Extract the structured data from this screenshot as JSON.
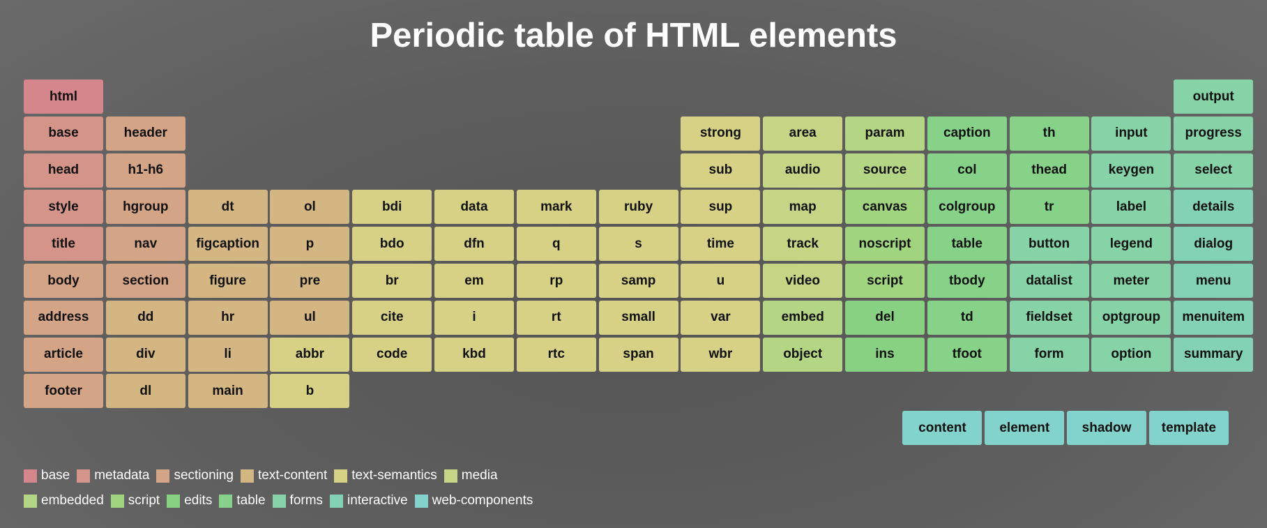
{
  "title": "Periodic table of HTML elements",
  "colors": {
    "base": "#d5868c",
    "metadata": "#d4948a",
    "sectioning": "#d4a487",
    "text-content": "#d4b683",
    "text-semantics": "#d6d185",
    "media": "#c5d485",
    "embedded": "#b4d583",
    "script": "#a1d47f",
    "edits": "#89d182",
    "table": "#86d289",
    "forms": "#85d3a6",
    "interactive": "#84d2b6",
    "web-components": "#83d3cd"
  },
  "elements": [
    {
      "label": "html",
      "col": 0,
      "row": 0,
      "cat": "base"
    },
    {
      "label": "base",
      "col": 0,
      "row": 1,
      "cat": "metadata"
    },
    {
      "label": "head",
      "col": 0,
      "row": 2,
      "cat": "metadata"
    },
    {
      "label": "style",
      "col": 0,
      "row": 3,
      "cat": "metadata"
    },
    {
      "label": "title",
      "col": 0,
      "row": 4,
      "cat": "metadata"
    },
    {
      "label": "body",
      "col": 0,
      "row": 5,
      "cat": "sectioning"
    },
    {
      "label": "address",
      "col": 0,
      "row": 6,
      "cat": "sectioning"
    },
    {
      "label": "article",
      "col": 0,
      "row": 7,
      "cat": "sectioning"
    },
    {
      "label": "footer",
      "col": 0,
      "row": 8,
      "cat": "sectioning"
    },
    {
      "label": "header",
      "col": 1,
      "row": 1,
      "cat": "sectioning"
    },
    {
      "label": "h1-h6",
      "col": 1,
      "row": 2,
      "cat": "sectioning"
    },
    {
      "label": "hgroup",
      "col": 1,
      "row": 3,
      "cat": "sectioning"
    },
    {
      "label": "nav",
      "col": 1,
      "row": 4,
      "cat": "sectioning"
    },
    {
      "label": "section",
      "col": 1,
      "row": 5,
      "cat": "sectioning"
    },
    {
      "label": "dd",
      "col": 1,
      "row": 6,
      "cat": "text-content"
    },
    {
      "label": "div",
      "col": 1,
      "row": 7,
      "cat": "text-content"
    },
    {
      "label": "dl",
      "col": 1,
      "row": 8,
      "cat": "text-content"
    },
    {
      "label": "dt",
      "col": 2,
      "row": 3,
      "cat": "text-content"
    },
    {
      "label": "figcaption",
      "col": 2,
      "row": 4,
      "cat": "text-content"
    },
    {
      "label": "figure",
      "col": 2,
      "row": 5,
      "cat": "text-content"
    },
    {
      "label": "hr",
      "col": 2,
      "row": 6,
      "cat": "text-content"
    },
    {
      "label": "li",
      "col": 2,
      "row": 7,
      "cat": "text-content"
    },
    {
      "label": "main",
      "col": 2,
      "row": 8,
      "cat": "text-content"
    },
    {
      "label": "ol",
      "col": 3,
      "row": 3,
      "cat": "text-content"
    },
    {
      "label": "p",
      "col": 3,
      "row": 4,
      "cat": "text-content"
    },
    {
      "label": "pre",
      "col": 3,
      "row": 5,
      "cat": "text-content"
    },
    {
      "label": "ul",
      "col": 3,
      "row": 6,
      "cat": "text-content"
    },
    {
      "label": "abbr",
      "col": 3,
      "row": 7,
      "cat": "text-semantics"
    },
    {
      "label": "b",
      "col": 3,
      "row": 8,
      "cat": "text-semantics"
    },
    {
      "label": "bdi",
      "col": 4,
      "row": 3,
      "cat": "text-semantics"
    },
    {
      "label": "bdo",
      "col": 4,
      "row": 4,
      "cat": "text-semantics"
    },
    {
      "label": "br",
      "col": 4,
      "row": 5,
      "cat": "text-semantics"
    },
    {
      "label": "cite",
      "col": 4,
      "row": 6,
      "cat": "text-semantics"
    },
    {
      "label": "code",
      "col": 4,
      "row": 7,
      "cat": "text-semantics"
    },
    {
      "label": "data",
      "col": 5,
      "row": 3,
      "cat": "text-semantics"
    },
    {
      "label": "dfn",
      "col": 5,
      "row": 4,
      "cat": "text-semantics"
    },
    {
      "label": "em",
      "col": 5,
      "row": 5,
      "cat": "text-semantics"
    },
    {
      "label": "i",
      "col": 5,
      "row": 6,
      "cat": "text-semantics"
    },
    {
      "label": "kbd",
      "col": 5,
      "row": 7,
      "cat": "text-semantics"
    },
    {
      "label": "mark",
      "col": 6,
      "row": 3,
      "cat": "text-semantics"
    },
    {
      "label": "q",
      "col": 6,
      "row": 4,
      "cat": "text-semantics"
    },
    {
      "label": "rp",
      "col": 6,
      "row": 5,
      "cat": "text-semantics"
    },
    {
      "label": "rt",
      "col": 6,
      "row": 6,
      "cat": "text-semantics"
    },
    {
      "label": "rtc",
      "col": 6,
      "row": 7,
      "cat": "text-semantics"
    },
    {
      "label": "ruby",
      "col": 7,
      "row": 3,
      "cat": "text-semantics"
    },
    {
      "label": "s",
      "col": 7,
      "row": 4,
      "cat": "text-semantics"
    },
    {
      "label": "samp",
      "col": 7,
      "row": 5,
      "cat": "text-semantics"
    },
    {
      "label": "small",
      "col": 7,
      "row": 6,
      "cat": "text-semantics"
    },
    {
      "label": "span",
      "col": 7,
      "row": 7,
      "cat": "text-semantics"
    },
    {
      "label": "strong",
      "col": 8,
      "row": 1,
      "cat": "text-semantics"
    },
    {
      "label": "sub",
      "col": 8,
      "row": 2,
      "cat": "text-semantics"
    },
    {
      "label": "sup",
      "col": 8,
      "row": 3,
      "cat": "text-semantics"
    },
    {
      "label": "time",
      "col": 8,
      "row": 4,
      "cat": "text-semantics"
    },
    {
      "label": "u",
      "col": 8,
      "row": 5,
      "cat": "text-semantics"
    },
    {
      "label": "var",
      "col": 8,
      "row": 6,
      "cat": "text-semantics"
    },
    {
      "label": "wbr",
      "col": 8,
      "row": 7,
      "cat": "text-semantics"
    },
    {
      "label": "area",
      "col": 9,
      "row": 1,
      "cat": "media"
    },
    {
      "label": "audio",
      "col": 9,
      "row": 2,
      "cat": "media"
    },
    {
      "label": "map",
      "col": 9,
      "row": 3,
      "cat": "media"
    },
    {
      "label": "track",
      "col": 9,
      "row": 4,
      "cat": "media"
    },
    {
      "label": "video",
      "col": 9,
      "row": 5,
      "cat": "media"
    },
    {
      "label": "embed",
      "col": 9,
      "row": 6,
      "cat": "embedded"
    },
    {
      "label": "object",
      "col": 9,
      "row": 7,
      "cat": "embedded"
    },
    {
      "label": "param",
      "col": 10,
      "row": 1,
      "cat": "embedded"
    },
    {
      "label": "source",
      "col": 10,
      "row": 2,
      "cat": "embedded"
    },
    {
      "label": "canvas",
      "col": 10,
      "row": 3,
      "cat": "script"
    },
    {
      "label": "noscript",
      "col": 10,
      "row": 4,
      "cat": "script"
    },
    {
      "label": "script",
      "col": 10,
      "row": 5,
      "cat": "script"
    },
    {
      "label": "del",
      "col": 10,
      "row": 6,
      "cat": "edits"
    },
    {
      "label": "ins",
      "col": 10,
      "row": 7,
      "cat": "edits"
    },
    {
      "label": "caption",
      "col": 11,
      "row": 1,
      "cat": "table"
    },
    {
      "label": "col",
      "col": 11,
      "row": 2,
      "cat": "table"
    },
    {
      "label": "colgroup",
      "col": 11,
      "row": 3,
      "cat": "table"
    },
    {
      "label": "table",
      "col": 11,
      "row": 4,
      "cat": "table"
    },
    {
      "label": "tbody",
      "col": 11,
      "row": 5,
      "cat": "table"
    },
    {
      "label": "td",
      "col": 11,
      "row": 6,
      "cat": "table"
    },
    {
      "label": "tfoot",
      "col": 11,
      "row": 7,
      "cat": "table"
    },
    {
      "label": "th",
      "col": 12,
      "row": 1,
      "cat": "table"
    },
    {
      "label": "thead",
      "col": 12,
      "row": 2,
      "cat": "table"
    },
    {
      "label": "tr",
      "col": 12,
      "row": 3,
      "cat": "table"
    },
    {
      "label": "button",
      "col": 12,
      "row": 4,
      "cat": "forms"
    },
    {
      "label": "datalist",
      "col": 12,
      "row": 5,
      "cat": "forms"
    },
    {
      "label": "fieldset",
      "col": 12,
      "row": 6,
      "cat": "forms"
    },
    {
      "label": "form",
      "col": 12,
      "row": 7,
      "cat": "forms"
    },
    {
      "label": "input",
      "col": 13,
      "row": 1,
      "cat": "forms"
    },
    {
      "label": "keygen",
      "col": 13,
      "row": 2,
      "cat": "forms"
    },
    {
      "label": "label",
      "col": 13,
      "row": 3,
      "cat": "forms"
    },
    {
      "label": "legend",
      "col": 13,
      "row": 4,
      "cat": "forms"
    },
    {
      "label": "meter",
      "col": 13,
      "row": 5,
      "cat": "forms"
    },
    {
      "label": "optgroup",
      "col": 13,
      "row": 6,
      "cat": "forms"
    },
    {
      "label": "option",
      "col": 13,
      "row": 7,
      "cat": "forms"
    },
    {
      "label": "output",
      "col": 14,
      "row": 0,
      "cat": "forms"
    },
    {
      "label": "progress",
      "col": 14,
      "row": 1,
      "cat": "forms"
    },
    {
      "label": "select",
      "col": 14,
      "row": 2,
      "cat": "forms"
    },
    {
      "label": "details",
      "col": 14,
      "row": 3,
      "cat": "interactive"
    },
    {
      "label": "dialog",
      "col": 14,
      "row": 4,
      "cat": "interactive"
    },
    {
      "label": "menu",
      "col": 14,
      "row": 5,
      "cat": "interactive"
    },
    {
      "label": "menuitem",
      "col": 14,
      "row": 6,
      "cat": "interactive"
    },
    {
      "label": "summary",
      "col": 14,
      "row": 7,
      "cat": "interactive"
    },
    {
      "label": "content",
      "col": 10.7,
      "row": 9,
      "cat": "web-components"
    },
    {
      "label": "element",
      "col": 11.7,
      "row": 9,
      "cat": "web-components"
    },
    {
      "label": "shadow",
      "col": 12.7,
      "row": 9,
      "cat": "web-components"
    },
    {
      "label": "template",
      "col": 13.7,
      "row": 9,
      "cat": "web-components"
    }
  ],
  "legend": {
    "rows": [
      [
        "base",
        "metadata",
        "sectioning",
        "text-content",
        "text-semantics",
        "media"
      ],
      [
        "embedded",
        "script",
        "edits",
        "table",
        "forms",
        "interactive",
        "web-components"
      ]
    ]
  }
}
